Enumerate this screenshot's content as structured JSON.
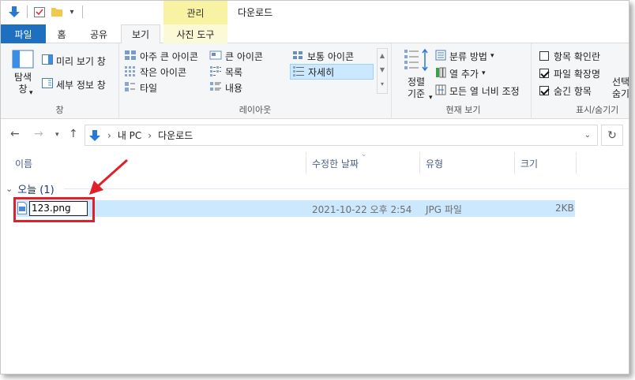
{
  "window": {
    "title": "다운로드"
  },
  "ribbon_context": {
    "header": "관리"
  },
  "tabs": {
    "file": "파일",
    "home": "홈",
    "share": "공유",
    "view": "보기",
    "picture_tools": "사진 도구"
  },
  "ribbon": {
    "pane": {
      "nav_pane": "탐색\n창",
      "preview_pane": "미리 보기 창",
      "details_pane": "세부 정보 창",
      "label": "창"
    },
    "layout": {
      "extra_large_icons": "아주 큰 아이콘",
      "large_icons": "큰 아이콘",
      "medium_icons": "보통 아이콘",
      "small_icons": "작은 아이콘",
      "list": "목록",
      "details": "자세히",
      "tiles": "타일",
      "content": "내용",
      "label": "레이아웃"
    },
    "current_view": {
      "sort_by": "정렬\n기준",
      "group_by": "분류 방법",
      "add_columns": "열 추가",
      "size_all_columns": "모든 열 너비 조정",
      "label": "현재 보기"
    },
    "show_hide": {
      "item_checkboxes": "항목 확인란",
      "item_checkboxes_checked": false,
      "file_extensions": "파일 확장명",
      "file_extensions_checked": true,
      "hidden_items": "숨긴 항목",
      "hidden_items_checked": true,
      "hide_selected": "선택\n숨기",
      "label": "표시/숨기기"
    }
  },
  "address": {
    "segments": [
      "내 PC",
      "다운로드"
    ]
  },
  "columns": {
    "name": "이름",
    "date": "수정한 날짜",
    "type": "유형",
    "size": "크기"
  },
  "groups": [
    {
      "label": "오늘 (1)"
    }
  ],
  "files": [
    {
      "name": "123.png",
      "date": "2021-10-22 오후 2:54",
      "type": "JPG 파일",
      "size": "2KB"
    }
  ],
  "colors": {
    "file_tab": "#1e6fbf",
    "context_header": "#f7f3a3",
    "selection": "#cce8ff",
    "annotation": "#e0202a"
  }
}
